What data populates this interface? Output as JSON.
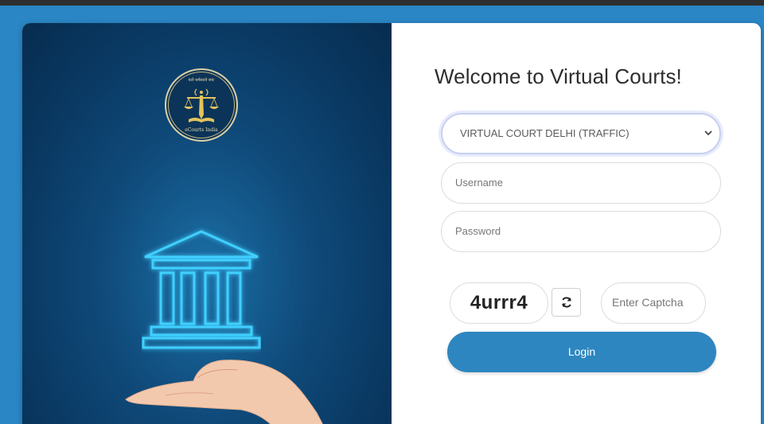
{
  "branding": {
    "emblem_motto": "यतो धर्मस्ततो जयः",
    "emblem_caption": "eCourts India"
  },
  "login": {
    "title": "Welcome to Virtual Courts!",
    "court_select": {
      "selected": "VIRTUAL COURT DELHI (TRAFFIC)"
    },
    "username": {
      "placeholder": "Username",
      "value": ""
    },
    "password": {
      "placeholder": "Password",
      "value": ""
    },
    "captcha": {
      "code": "4urrr4",
      "input_placeholder": "Enter Captcha"
    },
    "login_label": "Login"
  },
  "icons": {
    "dropdown": "chevron-down-icon",
    "refresh": "refresh-icon"
  },
  "colors": {
    "frame_blue": "#2b86c5",
    "panel_navy": "#093760",
    "glow_cyan": "#38c8ff",
    "button_blue": "#2d86c0"
  }
}
